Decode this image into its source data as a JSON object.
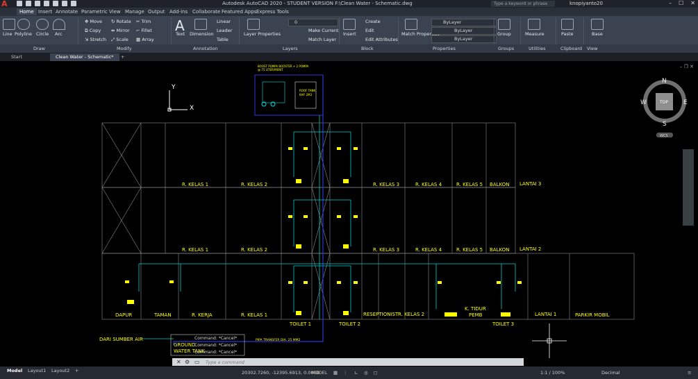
{
  "window": {
    "title": "Autodesk AutoCAD 2020 - STUDENT VERSION    F:\\Clean Water - Schematic.dwg",
    "search_placeholder": "Type a keyword or phrase",
    "user": "knopiyanto20"
  },
  "menu_tabs": [
    "Home",
    "Insert",
    "Annotate",
    "Parametric",
    "View",
    "Manage",
    "Output",
    "Add-ins",
    "Collaborate",
    "Featured Apps",
    "Express Tools"
  ],
  "ribbon": {
    "draw": {
      "line": "Line",
      "polyline": "Polyline",
      "circle": "Circle",
      "arc": "Arc"
    },
    "modify": {
      "move": "Move",
      "rotate": "Rotate",
      "trim": "Trim",
      "copy": "Copy",
      "mirror": "Mirror",
      "fillet": "Fillet",
      "stretch": "Stretch",
      "scale": "Scale",
      "array": "Array"
    },
    "annotation": {
      "text": "Text",
      "dimension": "Dimension",
      "linear": "Linear",
      "leader": "Leader",
      "table": "Table"
    },
    "layers": {
      "layer_properties": "Layer Properties",
      "layer_value": "0",
      "make_current": "Make Current",
      "match_layer": "Match Layer"
    },
    "block": {
      "insert": "Insert",
      "create": "Create",
      "edit": "Edit",
      "edit_attributes": "Edit Attributes"
    },
    "properties": {
      "match_properties": "Match Properties",
      "color": "ByLayer",
      "linetype": "ByLayer",
      "lineweight": "ByLayer"
    },
    "groups": {
      "group": "Group"
    },
    "utilities": {
      "measure": "Measure"
    },
    "clipboard": {
      "paste": "Paste"
    },
    "view": {
      "base": "Base"
    }
  },
  "panels": [
    "Draw",
    "Modify",
    "Annotation",
    "Layers",
    "Block",
    "Properties",
    "Groups",
    "Utilities",
    "Clipboard",
    "View"
  ],
  "file_tabs": [
    "Start",
    "Clean Water - Schematic*"
  ],
  "viewcube": {
    "n": "N",
    "s": "S",
    "e": "E",
    "w": "W",
    "top": "TOP",
    "wcs": "WCS"
  },
  "ucs": {
    "x": "X",
    "y": "Y"
  },
  "drawing": {
    "pump_note": "BOOST POMPA BOOSTER + 2 POMPA",
    "pump_note2": "@ 75 LITER/MENIT",
    "roof_tank": "ROOF TANK",
    "roof_tank2": "KAP. 2M3",
    "rooms_l3": [
      "R. KELAS 1",
      "R. KELAS 2",
      "R. KELAS 3",
      "R. KELAS 4",
      "R. KELAS 5",
      "BALKON",
      "LANTAI 3"
    ],
    "rooms_l2": [
      "R. KELAS 1",
      "R. KELAS 2",
      "R. KELAS 3",
      "R. KELAS 4",
      "R. KELAS 5",
      "BALKON",
      "LANTAI 2"
    ],
    "rooms_l1": [
      "DAPUR",
      "TAMAN",
      "R. KERJA",
      "R. KELAS 1",
      "TOILET 1",
      "TOILET 2",
      "RESEPTIONIST",
      "R. KELAS 2",
      "K. TIDUR",
      "PEMB",
      "TOILET 3",
      "LANTAI 1",
      "PARKIR MOBIL"
    ],
    "source": "DARI SUMBER AIR",
    "ground_tank": "GROUND",
    "ground_tank2": "WATER TANK",
    "pipe_note": "PIPA TRANSFER DIA. 25 MM2"
  },
  "command": {
    "history": [
      "Command: *Cancel*",
      "Command: *Cancel*",
      "Command: *Cancel*"
    ],
    "placeholder": "Type a command"
  },
  "status": {
    "tabs": [
      "Model",
      "Layout1",
      "Layout2"
    ],
    "coordinates": "20302.7260, -12395.6913, 0.0000",
    "space": "MODEL",
    "scale": "1:1 / 100%",
    "units": "Decimal"
  }
}
